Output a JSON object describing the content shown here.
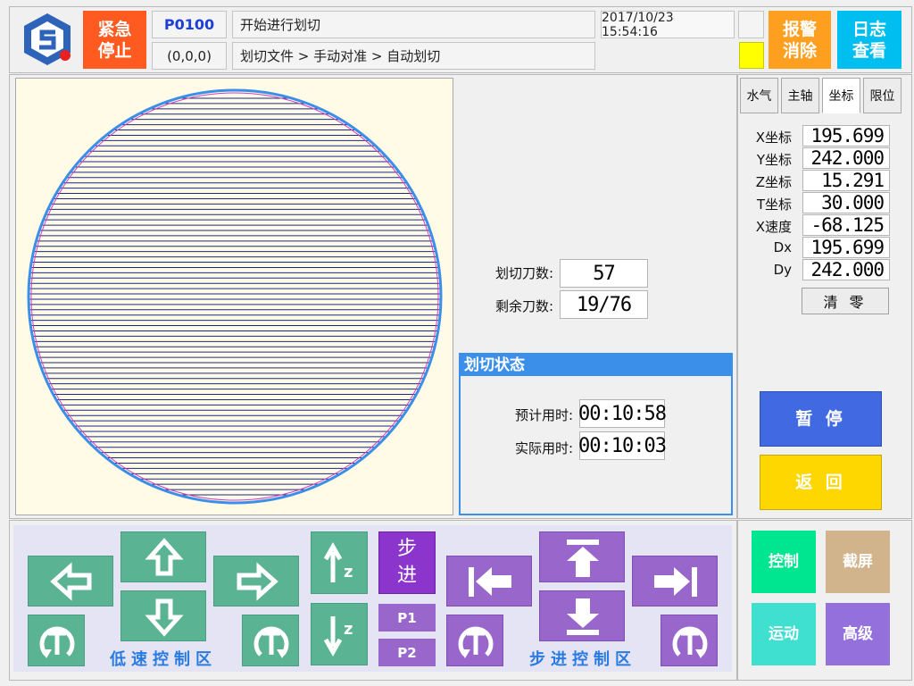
{
  "header": {
    "emergency_stop": "紧急\n停止",
    "program_code": "P0100",
    "coords": "(0,0,0)",
    "status_message": "开始进行划切",
    "breadcrumb": "划切文件 > 手动对准 > 自动划切",
    "datetime": "2017/10/23 15:54:16",
    "alarm_clear": "报警\n消除",
    "log_view": "日志\n查看"
  },
  "tabs": [
    "水气",
    "主轴",
    "坐标",
    "限位"
  ],
  "active_tab": "坐标",
  "coordinates": [
    {
      "label": "X坐标",
      "value": "195.699"
    },
    {
      "label": "Y坐标",
      "value": "242.000"
    },
    {
      "label": "Z坐标",
      "value": "15.291"
    },
    {
      "label": "T坐标",
      "value": "30.000"
    },
    {
      "label": "X速度",
      "value": "-68.125"
    },
    {
      "label": "Dx",
      "value": "195.699"
    },
    {
      "label": "Dy",
      "value": "242.000"
    }
  ],
  "clear_button": "清 零",
  "cut_info": {
    "cut_count_label": "划切刀数:",
    "cut_count": "57",
    "remaining_label": "剩余刀数:",
    "remaining": "19/76"
  },
  "cut_status": {
    "title": "划切状态",
    "estimated_label": "预计用时:",
    "estimated": "00:10:58",
    "actual_label": "实际用时:",
    "actual": "00:10:03"
  },
  "actions": {
    "pause": "暂 停",
    "back": "返 回"
  },
  "bottom_right": {
    "control": "控制",
    "screenshot": "截屏",
    "motion": "运动",
    "advanced": "高级"
  },
  "low_speed_zone": "低速控制区",
  "step_zone": "步进控制区",
  "step_button": "步\n进",
  "p1": "P1",
  "p2": "P2",
  "colors": {
    "emergency": "#ff5a1f",
    "alarm": "#ff9f1f",
    "log": "#00bff0",
    "pause": "#4169e1",
    "back": "#ffd700",
    "green_btn": "#5ab393",
    "purple_btn": "#9966cc",
    "control": "#00e58f",
    "screenshot": "#d2b48c",
    "motion": "#40e0d0",
    "advanced": "#9370db"
  }
}
